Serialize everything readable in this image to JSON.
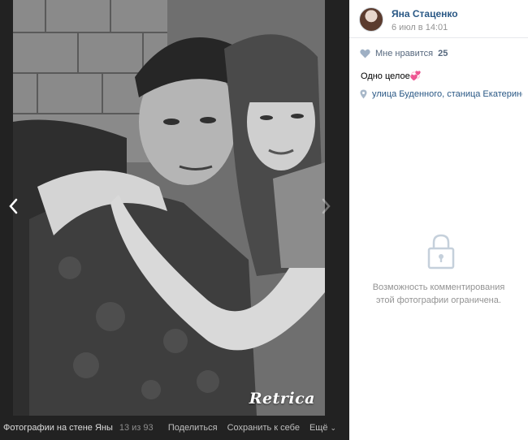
{
  "viewer": {
    "watermark": "Retrica",
    "album_title": "Фотографии на стене Яны",
    "counter": "13 из 93",
    "actions": {
      "share": "Поделиться",
      "save": "Сохранить к себе",
      "more": "Ещё"
    }
  },
  "sidebar": {
    "author_name": "Яна Стаценко",
    "date": "6 июл в 14:01",
    "likes_label": "Мне нравится",
    "likes_count": "25",
    "caption": "Одно целое💞",
    "location": "улица Буденного, станица Екатериног…",
    "comments_restricted": "Возможность комментирования этой фотографии ограничена."
  },
  "colors": {
    "link": "#2a5885",
    "muted": "#939393",
    "viewer_bg": "#222222"
  }
}
